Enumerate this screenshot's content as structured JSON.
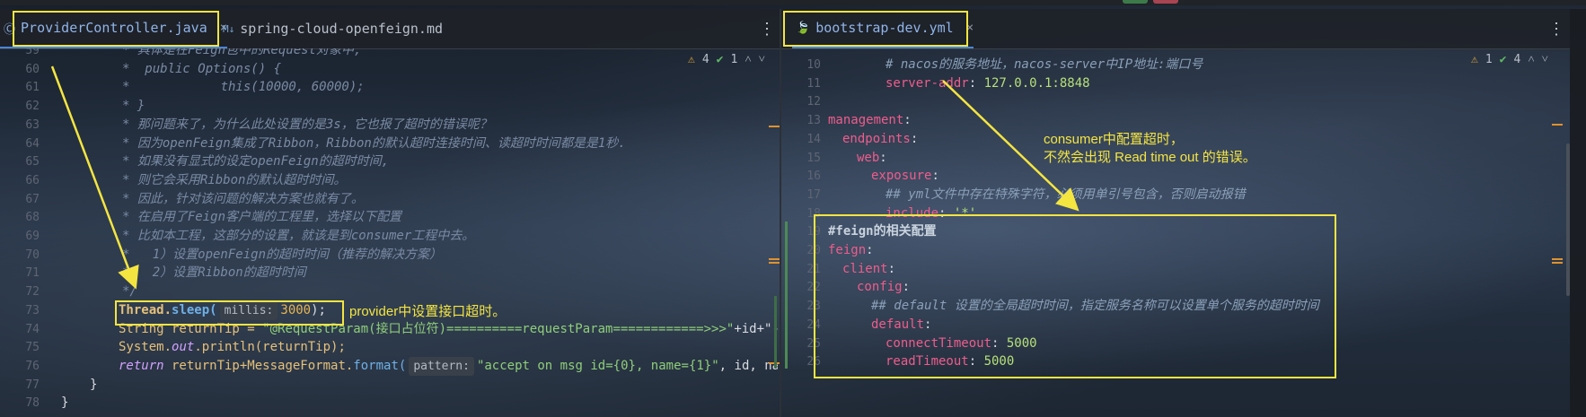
{
  "left_tabs": [
    {
      "icon": "Ⓒ",
      "label": "ProviderController.java"
    },
    {
      "icon": "M↓",
      "label": "spring-cloud-openfeign.md"
    }
  ],
  "right_tabs": [
    {
      "icon": "🍃",
      "label": "bootstrap-dev.yml"
    }
  ],
  "left_inspect": {
    "warnings": "4",
    "ok": "1"
  },
  "right_inspect": {
    "errors": "1",
    "ok": "4"
  },
  "left_lines": [
    {
      "n": "59",
      "text": "* 具体是在Feign包中的Request对象中,"
    },
    {
      "n": "60",
      "text": "*  public Options() {"
    },
    {
      "n": "61",
      "text": "*            this(10000, 60000);"
    },
    {
      "n": "62",
      "text": "* }"
    },
    {
      "n": "63",
      "text": "* 那问题来了，为什么此处设置的是3s，它也报了超时的错误呢？"
    },
    {
      "n": "64",
      "text": "* 因为openFeign集成了Ribbon，Ribbon的默认超时连接时间、读超时时间都是是1秒."
    },
    {
      "n": "65",
      "text": "* 如果没有显式的设定openFeign的超时时间,"
    },
    {
      "n": "66",
      "text": "* 则它会采用Ribbon的默认超时时间。"
    },
    {
      "n": "67",
      "text": "* 因此，针对该问题的解决方案也就有了。"
    },
    {
      "n": "68",
      "text": "* 在启用了Feign客户端的工程里，选择以下配置"
    },
    {
      "n": "69",
      "text": "* 比如本工程，这部分的设置，就该是到consumer工程中去。"
    },
    {
      "n": "70",
      "text": "*   1）设置openFeign的超时时间（推荐的解决方案）"
    },
    {
      "n": "71",
      "text": "*   2）设置Ribbon的超时时间"
    },
    {
      "n": "72",
      "text": "*/"
    }
  ],
  "code": {
    "l73_n": "73",
    "l73_a": "Thread.",
    "l73_b": "sleep(",
    "l73_hint": "millis:",
    "l73_val": "3000",
    "l73_c": ");",
    "l74_n": "74",
    "l74_a": "String returnTip = ",
    "l74_str": "\"@RequestParam(接口占位符)==========requestParam============>>>\"",
    "l74_b": "+id+\"---\"+",
    "l75_n": "75",
    "l75_a": "System.",
    "l75_b": "out",
    "l75_c": ".println(returnTip);",
    "l76_n": "76",
    "l76_kw": "return",
    "l76_a": " returnTip+MessageFormat.",
    "l76_b": "format(",
    "l76_hint": "pattern:",
    "l76_str": "\"accept on msg id={0}, name={1}\"",
    "l76_c": ", id, name);",
    "l77_n": "77",
    "l77": "}",
    "l78_n": "78",
    "l78": "}"
  },
  "yaml_lines": [
    {
      "n": "10",
      "indent": 4,
      "type": "comment",
      "text": "# nacos的服务地址，nacos-server中IP地址:端口号"
    },
    {
      "n": "11",
      "indent": 4,
      "type": "kv",
      "key": "server-addr",
      "value": "127.0.0.1:8848"
    },
    {
      "n": "12",
      "indent": 0,
      "type": "blank"
    },
    {
      "n": "13",
      "indent": 0,
      "type": "key",
      "key": "management"
    },
    {
      "n": "14",
      "indent": 1,
      "type": "key",
      "key": "endpoints"
    },
    {
      "n": "15",
      "indent": 2,
      "type": "key",
      "key": "web"
    },
    {
      "n": "16",
      "indent": 3,
      "type": "key",
      "key": "exposure"
    },
    {
      "n": "17",
      "indent": 4,
      "type": "comment",
      "text": "## yml文件中存在特殊字符，必须用单引号包含，否则启动报错"
    },
    {
      "n": "18",
      "indent": 4,
      "type": "kv",
      "key": "include",
      "value": "'*'"
    },
    {
      "n": "19",
      "indent": 0,
      "type": "comment",
      "text": "#feign的相关配置"
    },
    {
      "n": "20",
      "indent": 0,
      "type": "key",
      "key": "feign"
    },
    {
      "n": "21",
      "indent": 1,
      "type": "key",
      "key": "client"
    },
    {
      "n": "22",
      "indent": 2,
      "type": "key",
      "key": "config"
    },
    {
      "n": "23",
      "indent": 3,
      "type": "comment",
      "text": "## default 设置的全局超时时间，指定服务名称可以设置单个服务的超时时间"
    },
    {
      "n": "24",
      "indent": 3,
      "type": "key",
      "key": "default"
    },
    {
      "n": "25",
      "indent": 4,
      "type": "kv",
      "key": "connectTimeout",
      "value": "5000"
    },
    {
      "n": "26",
      "indent": 4,
      "type": "kv",
      "key": "readTimeout",
      "value": "5000"
    }
  ],
  "annotations": {
    "provider_note": "provider中设置接口超时。",
    "consumer_note_1": "consumer中配置超时，",
    "consumer_note_2": "不然会出现 Read time out 的错误。"
  },
  "colors": {
    "highlight": "#f4e541",
    "accent": "#4a87d6"
  }
}
